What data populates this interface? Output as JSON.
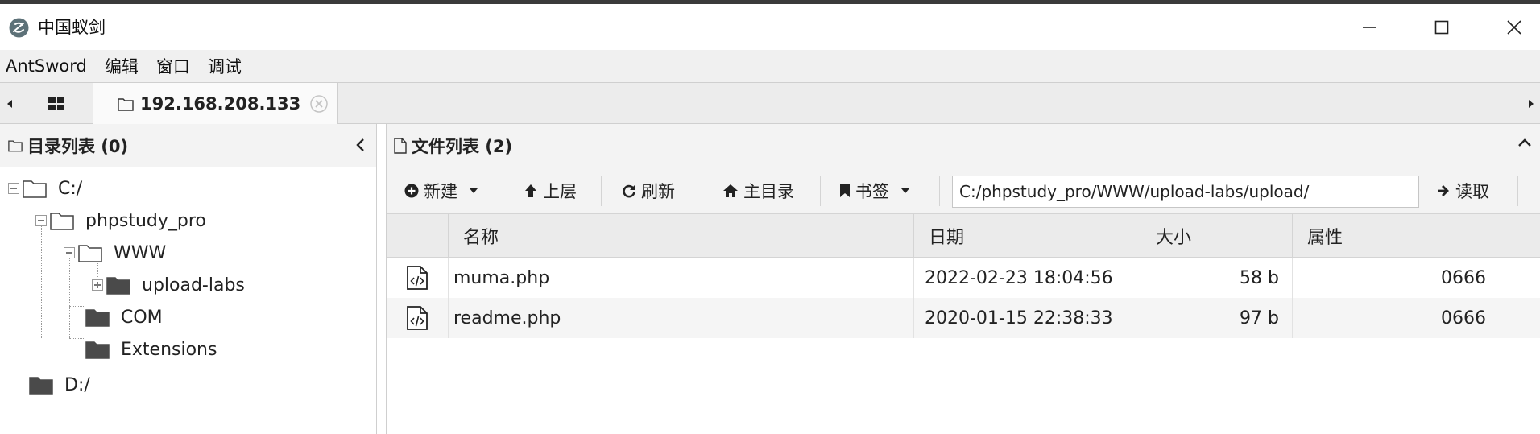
{
  "window": {
    "title": "中国蚁剑"
  },
  "menu": [
    "AntSword",
    "编辑",
    "窗口",
    "调试"
  ],
  "tabs": {
    "active_label": "192.168.208.133"
  },
  "dir_panel": {
    "title": "目录列表 (0)",
    "tree": [
      {
        "label": "C:/"
      },
      {
        "label": "phpstudy_pro"
      },
      {
        "label": "WWW"
      },
      {
        "label": "upload-labs"
      },
      {
        "label": "COM"
      },
      {
        "label": "Extensions"
      },
      {
        "label": "D:/"
      }
    ]
  },
  "file_panel": {
    "title": "文件列表 (2)",
    "toolbar": {
      "new_label": "新建",
      "up_label": "上层",
      "refresh_label": "刷新",
      "home_label": "主目录",
      "bookmark_label": "书签",
      "path_value": "C:/phpstudy_pro/WWW/upload-labs/upload/",
      "read_label": "读取"
    },
    "columns": {
      "name": "名称",
      "date": "日期",
      "size": "大小",
      "attr": "属性"
    },
    "rows": [
      {
        "name": "muma.php",
        "date": "2022-02-23 18:04:56",
        "size": "58 b",
        "attr": "0666"
      },
      {
        "name": "readme.php",
        "date": "2020-01-15 22:38:33",
        "size": "97 b",
        "attr": "0666"
      }
    ]
  },
  "colors": {
    "header_bg": "#f3f3f3",
    "border": "#cfcfcf",
    "folder": "#4a4a4a",
    "icon_accent": "#5d7178"
  }
}
